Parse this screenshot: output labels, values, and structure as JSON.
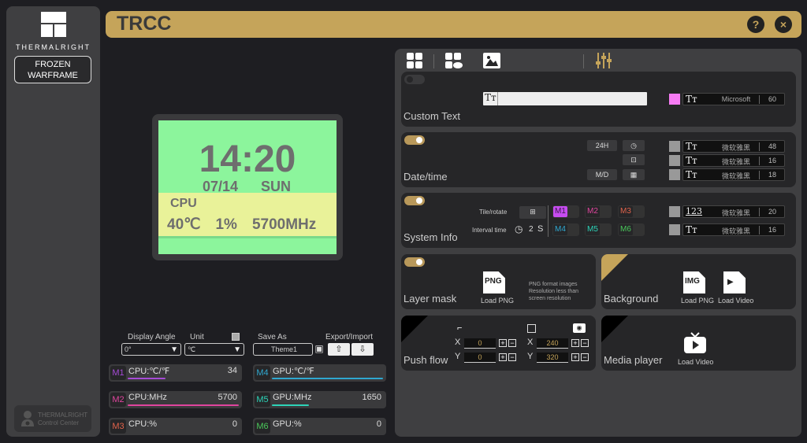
{
  "app": {
    "title": "TRCC",
    "brand": "THERMALRIGHT",
    "device_label_line1": "FROZEN",
    "device_label_line2": "WARFRAME",
    "footer_line1": "THERMALRIGHT",
    "footer_line2": "Control Center",
    "help_icon": "?",
    "close_icon": "×"
  },
  "preview": {
    "time": "14:20",
    "date": "07/14",
    "day": "SUN",
    "section": "CPU",
    "temp": "40℃",
    "usage": "1%",
    "freq": "5700MHz"
  },
  "controls": {
    "display_angle_label": "Display Angle",
    "display_angle_value": "0°",
    "unit_label": "Unit",
    "unit_value": "℃",
    "save_as_label": "Save As",
    "theme_name": "Theme1",
    "export_import_label": "Export/Import"
  },
  "metrics": [
    {
      "tag": "M1",
      "label": "CPU:℃/℉",
      "value": "34",
      "color": "#a64bd6",
      "fill": 0.34
    },
    {
      "tag": "M2",
      "label": "CPU:MHz",
      "value": "5700",
      "color": "#e0459e",
      "fill": 1.0
    },
    {
      "tag": "M3",
      "label": "CPU:%",
      "value": "0",
      "color": "#e0634b",
      "fill": 0
    },
    {
      "tag": "M4",
      "label": "GPU:℃/℉",
      "value": "",
      "color": "#2fa8d0",
      "fill": 1.0
    },
    {
      "tag": "M5",
      "label": "GPU:MHz",
      "value": "1650",
      "color": "#2dd4b8",
      "fill": 0.33
    },
    {
      "tag": "M6",
      "label": "GPU:%",
      "value": "0",
      "color": "#4ac85a",
      "fill": 0
    }
  ],
  "panel": {
    "custom_text": {
      "title": "Custom Text",
      "enabled": false,
      "text_value": "",
      "color": "#f77bf4",
      "font": "Microsoft",
      "size": "60"
    },
    "datetime": {
      "title": "Date/time",
      "enabled": true,
      "hour_format": "24H",
      "date_format": "M/D",
      "fonts": [
        {
          "font": "微软雅黑",
          "size": "48"
        },
        {
          "font": "微软雅黑",
          "size": "16"
        },
        {
          "font": "微软雅黑",
          "size": "18"
        }
      ]
    },
    "sysinfo": {
      "title": "System Info",
      "enabled": true,
      "tile_label": "Tile/rotate",
      "interval_label": "Interval time",
      "interval_value": "2",
      "interval_unit": "S",
      "slots": [
        "M1",
        "M2",
        "M3",
        "M4",
        "M5",
        "M6"
      ],
      "fonts": [
        {
          "icon": "123",
          "font": "微软雅黑",
          "size": "20"
        },
        {
          "icon": "Tт",
          "font": "微软雅黑",
          "size": "16"
        }
      ]
    },
    "layer_mask": {
      "title": "Layer mask",
      "enabled": true,
      "load_label": "Load PNG",
      "file_type": "PNG",
      "hint1": "PNG format images",
      "hint2": "Resolution less than",
      "hint3": "screen resolution"
    },
    "background": {
      "title": "Background",
      "load_png": "Load PNG",
      "load_video": "Load Video",
      "file_type": "IMG"
    },
    "push_flow": {
      "title": "Push flow",
      "x1": "0",
      "y1": "0",
      "x2": "240",
      "y2": "320",
      "x_label": "X",
      "y_label": "Y"
    },
    "media_player": {
      "title": "Media player",
      "load_video": "Load Video"
    }
  }
}
